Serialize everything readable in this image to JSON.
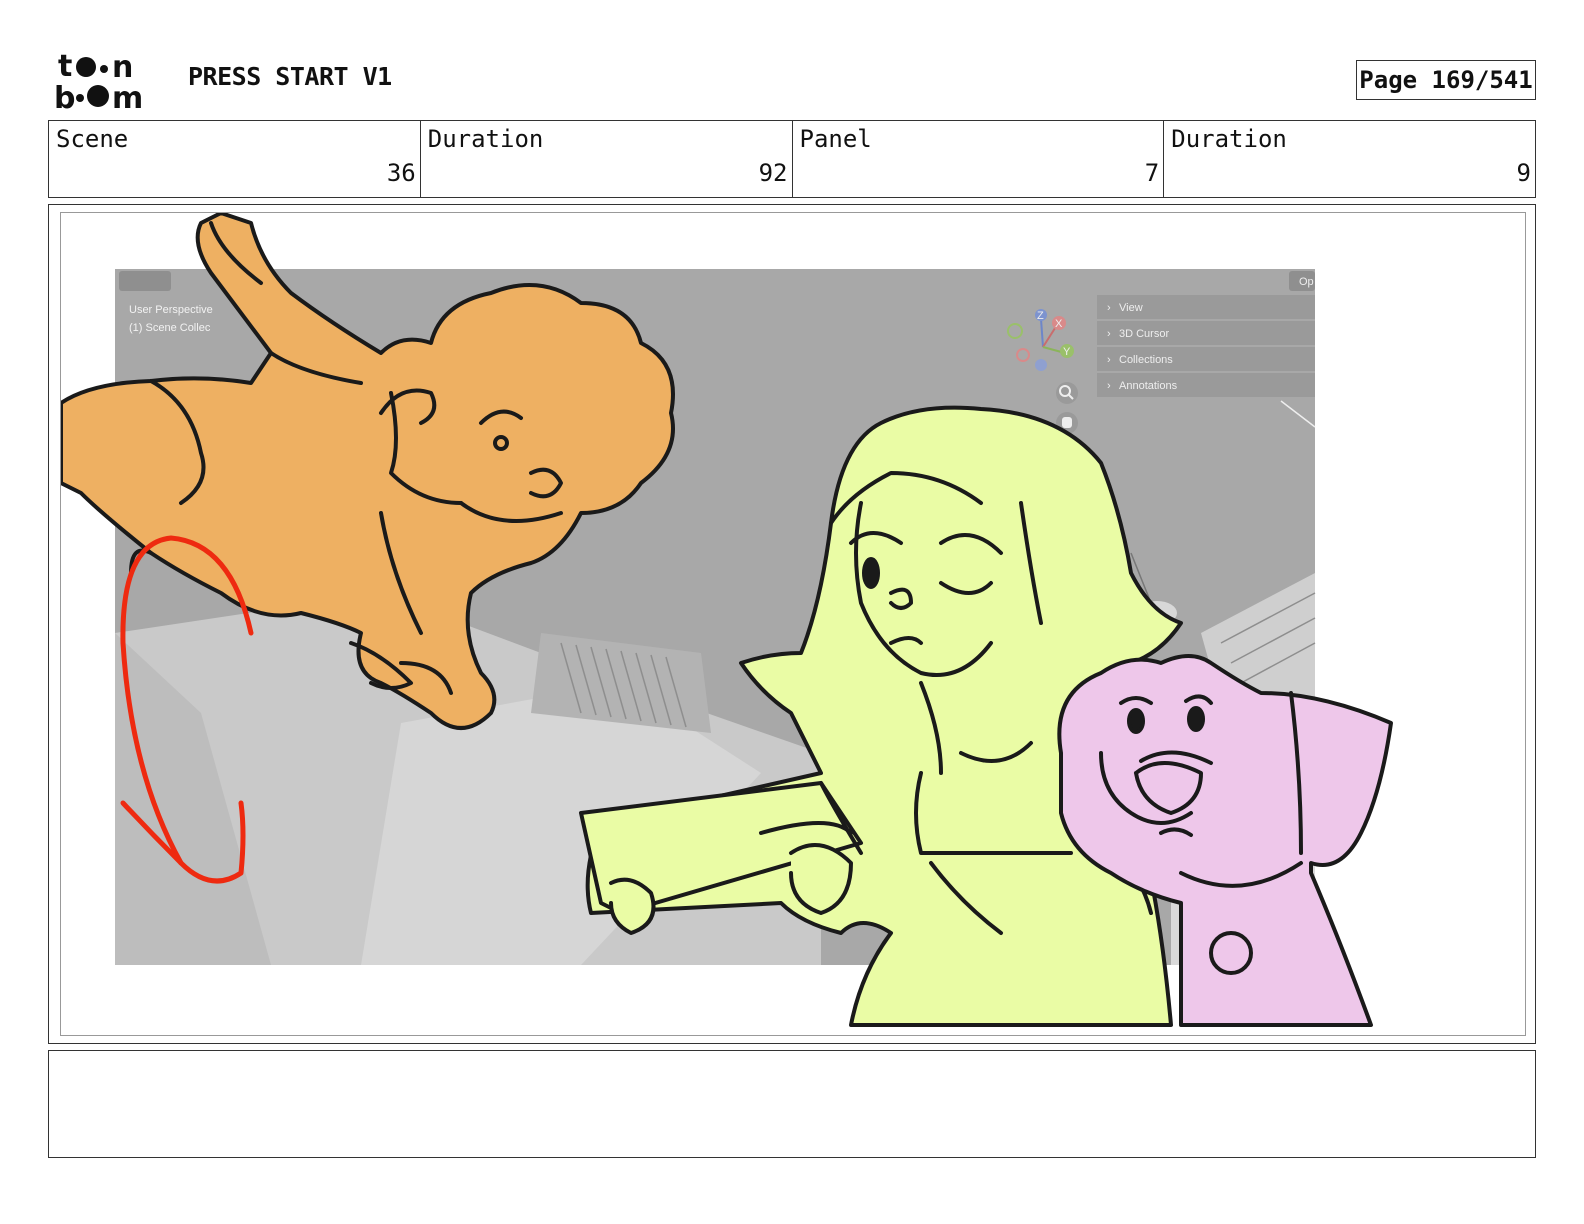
{
  "header": {
    "logo_text": "toon boom",
    "project_title": "PRESS START V1",
    "page_label": "Page 169/541"
  },
  "info": [
    {
      "label": "Scene",
      "value": "36"
    },
    {
      "label": "Duration",
      "value": "92"
    },
    {
      "label": "Panel",
      "value": "7"
    },
    {
      "label": "Duration",
      "value": "9"
    }
  ],
  "viewport": {
    "perspective_label": "User Perspective",
    "collection_label": "(1) Scene Collec",
    "corner_label": "Op",
    "sidebar_items": [
      "View",
      "3D Cursor",
      "Collections",
      "Annotations"
    ],
    "gizmo_axes": [
      "Z",
      "X",
      "Y"
    ]
  },
  "notes": {
    "text": ""
  },
  "colors": {
    "monkey_fill": "#eeb062",
    "girl_fill": "#eafca5",
    "dog_fill": "#eec7ea",
    "arrow": "#ee2a10",
    "viewport_bg": "#a9a9a9"
  }
}
